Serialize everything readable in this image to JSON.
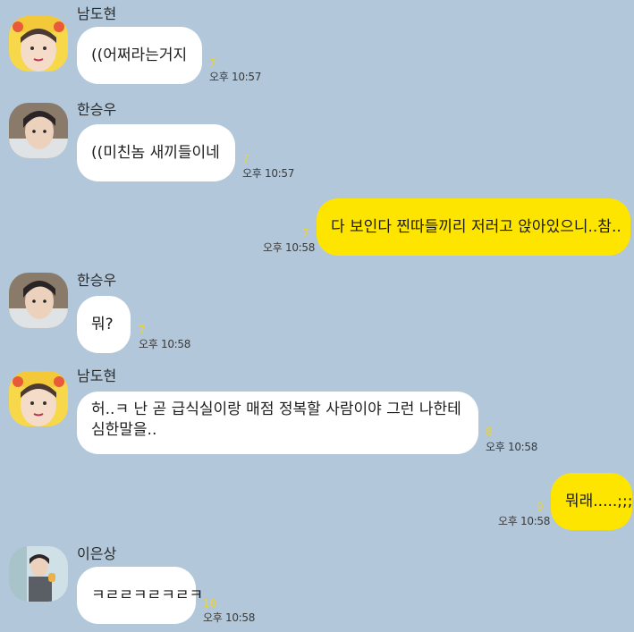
{
  "messages": [
    {
      "sender": "남도현",
      "text": "((어쩌라는거지",
      "unread": "7",
      "time": "오후 10:57"
    },
    {
      "sender": "한승우",
      "text": "((미친놈 새끼들이네",
      "unread": "7",
      "time": "오후 10:57"
    },
    {
      "sender": "",
      "text": "다 보인다 찐따들끼리 저러고 앉아있으니..참..",
      "unread": "7",
      "time": "오후 10:58"
    },
    {
      "sender": "한승우",
      "text": "뭐?",
      "unread": "7",
      "time": "오후 10:58"
    },
    {
      "sender": "남도현",
      "text_line1": "허..ㅋ 난 곧 급식실이랑 매점 정복할 사람이야 그런 나한테",
      "text_line2": "심한말을..",
      "unread": "8",
      "time": "오후 10:58"
    },
    {
      "sender": "",
      "text": "뭐래.....;;;",
      "unread": "9",
      "time": "오후 10:58"
    },
    {
      "sender": "이은상",
      "text": "ㅋㄹㄹㅋㄹㅋㄹㅋ",
      "unread": "10",
      "time": "오후 10:58"
    }
  ],
  "colors": {
    "background": "#b2c7da",
    "incoming_bubble": "#ffffff",
    "outgoing_bubble": "#fee500",
    "unread_count": "#e8d33a"
  }
}
